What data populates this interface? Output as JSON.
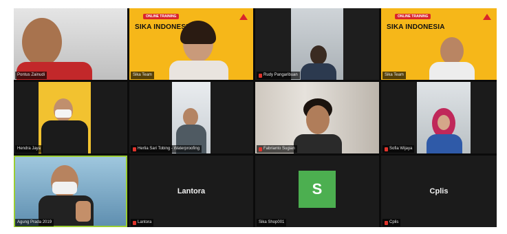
{
  "tiles": [
    {
      "id": "t1",
      "name": "Pontus Zainudi",
      "muted": false
    },
    {
      "id": "t2",
      "name": "Sika Team",
      "muted": false,
      "banner": {
        "chip": "ONLINE TRAINING",
        "title": "SIKA INDONESIA"
      }
    },
    {
      "id": "t3",
      "name": "Rudy Pangaribuan",
      "muted": true
    },
    {
      "id": "t4",
      "name": "Sika Team",
      "muted": false,
      "banner": {
        "chip": "ONLINE TRAINING",
        "title": "SIKA INDONESIA"
      }
    },
    {
      "id": "t5",
      "name": "Hendra Jaya",
      "muted": false
    },
    {
      "id": "t6",
      "name": "Herlia Sari Tobing - Waterproofing",
      "muted": true
    },
    {
      "id": "t7",
      "name": "Fabrianto Sugian",
      "muted": true
    },
    {
      "id": "t8",
      "name": "Sofia Wijaya",
      "muted": true
    },
    {
      "id": "t9",
      "name": "Agung Prada 2019",
      "muted": false,
      "active": true
    },
    {
      "id": "t10",
      "name": "Lantora",
      "muted": true,
      "center_label": "Lantora"
    },
    {
      "id": "t11",
      "name": "Sika Shop001",
      "muted": false,
      "avatar_letter": "S"
    },
    {
      "id": "t12",
      "name": "Cplis",
      "muted": true,
      "center_label": "Cplis"
    }
  ],
  "colors": {
    "active_border": "#9acd32",
    "mute": "#e0332b",
    "banner": "#f6b719",
    "avatar": "#4caf50"
  }
}
